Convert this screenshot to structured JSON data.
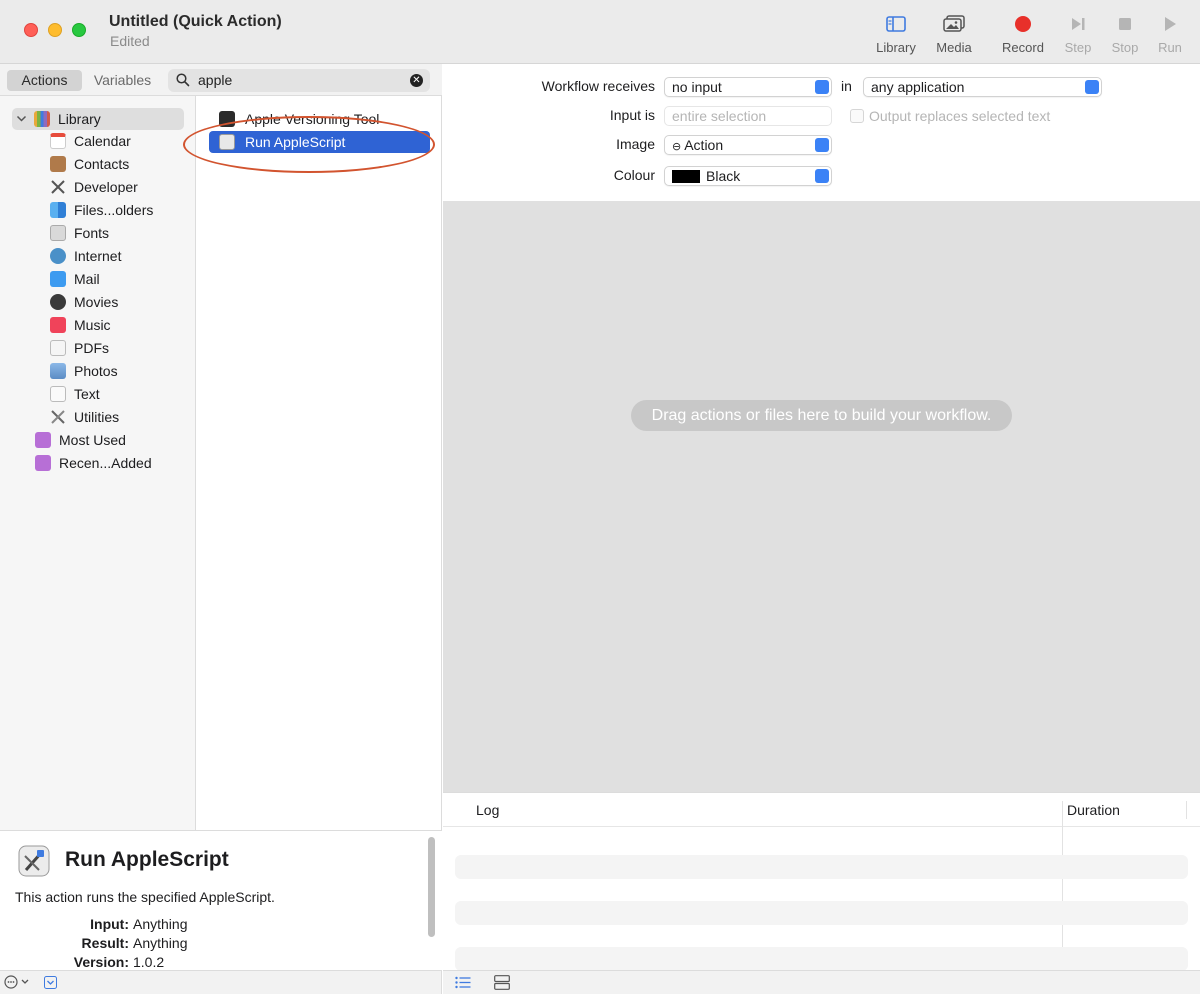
{
  "window": {
    "title": "Untitled (Quick Action)",
    "subtitle": "Edited"
  },
  "toolbar": {
    "library_label": "Library",
    "media_label": "Media",
    "record_label": "Record",
    "step_label": "Step",
    "stop_label": "Stop",
    "run_label": "Run",
    "colors": {
      "record": "#e8302a",
      "library_icon": "#3f7be0",
      "disabled": "#b5b5b5"
    }
  },
  "left_tabs": {
    "actions": "Actions",
    "variables": "Variables"
  },
  "search": {
    "value": "apple",
    "icon": "search-icon",
    "clear_icon": "clear-icon"
  },
  "library": {
    "root": "Library",
    "items": [
      {
        "label": "Calendar",
        "icon": "calendar-icon"
      },
      {
        "label": "Contacts",
        "icon": "contacts-icon"
      },
      {
        "label": "Developer",
        "icon": "developer-icon"
      },
      {
        "label": "Files...olders",
        "icon": "finder-icon"
      },
      {
        "label": "Fonts",
        "icon": "fonts-icon"
      },
      {
        "label": "Internet",
        "icon": "globe-icon"
      },
      {
        "label": "Mail",
        "icon": "mail-icon"
      },
      {
        "label": "Movies",
        "icon": "movies-icon"
      },
      {
        "label": "Music",
        "icon": "music-icon"
      },
      {
        "label": "PDFs",
        "icon": "pdf-icon"
      },
      {
        "label": "Photos",
        "icon": "photos-icon"
      },
      {
        "label": "Text",
        "icon": "text-icon"
      },
      {
        "label": "Utilities",
        "icon": "utilities-icon"
      }
    ],
    "smart_groups": [
      {
        "label": "Most Used",
        "icon": "smart-folder-icon"
      },
      {
        "label": "Recen...Added",
        "icon": "smart-folder-icon"
      }
    ]
  },
  "actions_list": [
    {
      "label": "Apple Versioning Tool",
      "icon": "terminal-icon",
      "selected": false
    },
    {
      "label": "Run AppleScript",
      "icon": "script-editor-icon",
      "selected": true
    }
  ],
  "description": {
    "title": "Run AppleScript",
    "text": "This action runs the specified AppleScript.",
    "input_key": "Input:",
    "input_value": "Anything",
    "result_key": "Result:",
    "result_value": "Anything",
    "version_key": "Version:",
    "version_value": "1.0.2"
  },
  "inspector": {
    "workflow_receives_label": "Workflow receives",
    "workflow_receives_value": "no input",
    "in_label": "in",
    "application_value": "any application",
    "input_is_label": "Input is",
    "input_is_value": "entire selection",
    "output_replaces_label": "Output replaces selected text",
    "image_label": "Image",
    "image_value": "Action",
    "colour_label": "Colour",
    "colour_value": "Black",
    "colour_swatch": "#000000"
  },
  "workflow": {
    "hint": "Drag actions or files here to build your workflow."
  },
  "log": {
    "col_log": "Log",
    "col_duration": "Duration"
  }
}
